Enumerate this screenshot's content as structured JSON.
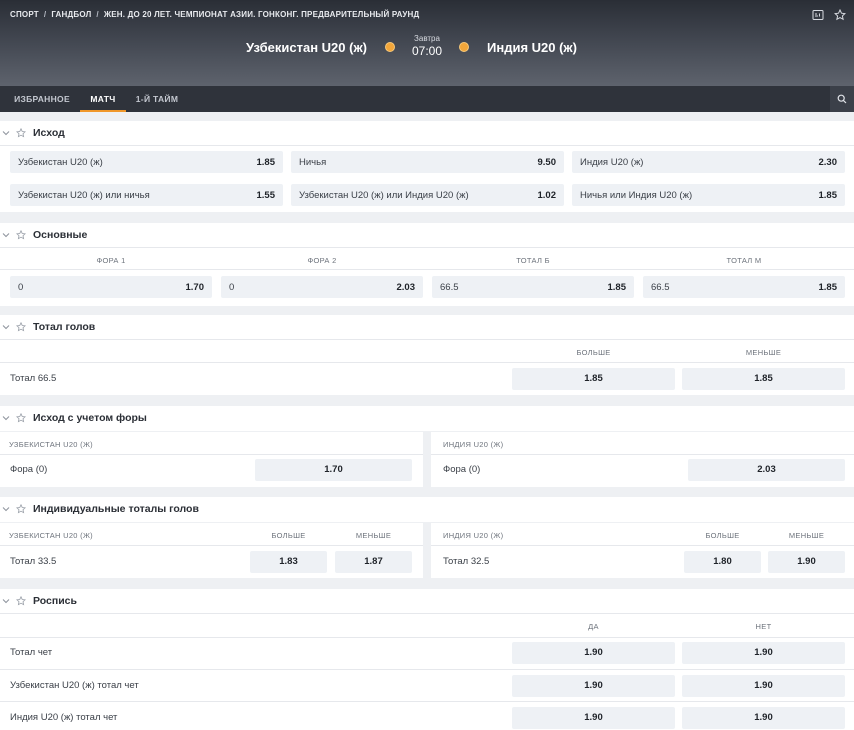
{
  "breadcrumbs": [
    "СПОРТ",
    "ГАНДБОЛ",
    "ЖЕН. ДО 20 ЛЕТ. ЧЕМПИОНАТ АЗИИ. ГОНКОНГ. ПРЕДВАРИТЕЛЬНЫЙ РАУНД"
  ],
  "breadcrumb_sep": "/",
  "icons": {
    "header": [
      "scoreboard-icon",
      "star-icon"
    ],
    "search": "search-icon",
    "collapse": "chevron-down-icon",
    "favorite": "star-icon"
  },
  "colors": {
    "accent": "#f0972a",
    "header_bg": "#2a2e36",
    "cell_bg": "#eef1f5"
  },
  "match": {
    "home": "Узбекистан U20 (ж)",
    "away": "Индия U20 (ж)",
    "day": "Завтра",
    "time": "07:00"
  },
  "tabs": [
    "ИЗБРАННОЕ",
    "МАТЧ",
    "1-Й ТАЙМ"
  ],
  "active_tab": "МАТЧ",
  "outcome": {
    "title": "Исход",
    "rows": [
      [
        {
          "label": "Узбекистан U20 (ж)",
          "odd": "1.85"
        },
        {
          "label": "Ничья",
          "odd": "9.50"
        },
        {
          "label": "Индия U20 (ж)",
          "odd": "2.30"
        }
      ],
      [
        {
          "label": "Узбекистан U20 (ж) или ничья",
          "odd": "1.55"
        },
        {
          "label": "Узбекистан U20 (ж) или Индия U20 (ж)",
          "odd": "1.02"
        },
        {
          "label": "Ничья или Индия U20 (ж)",
          "odd": "1.85"
        }
      ]
    ]
  },
  "main_markets": {
    "title": "Основные",
    "columns": [
      "ФОРА 1",
      "ФОРА 2",
      "ТОТАЛ Б",
      "ТОТАЛ М"
    ],
    "cells": [
      {
        "label": "0",
        "odd": "1.70"
      },
      {
        "label": "0",
        "odd": "2.03"
      },
      {
        "label": "66.5",
        "odd": "1.85"
      },
      {
        "label": "66.5",
        "odd": "1.85"
      }
    ]
  },
  "total_goals": {
    "title": "Тотал голов",
    "columns": [
      "БОЛЬШЕ",
      "МЕНЬШЕ"
    ],
    "row": {
      "label": "Тотал 66.5",
      "over": "1.85",
      "under": "1.85"
    }
  },
  "handicap": {
    "title": "Исход с учетом форы",
    "left": {
      "team": "УЗБЕКИСТАН U20 (Ж)",
      "label": "Фора (0)",
      "odd": "1.70"
    },
    "right": {
      "team": "ИНДИЯ U20 (Ж)",
      "label": "Фора (0)",
      "odd": "2.03"
    }
  },
  "individual_totals": {
    "title": "Индивидуальные тоталы голов",
    "columns": [
      "БОЛЬШЕ",
      "МЕНЬШЕ"
    ],
    "left": {
      "team": "УЗБЕКИСТАН U20 (Ж)",
      "label": "Тотал 33.5",
      "over": "1.83",
      "under": "1.87"
    },
    "right": {
      "team": "ИНДИЯ U20 (Ж)",
      "label": "Тотал 32.5",
      "over": "1.80",
      "under": "1.90"
    }
  },
  "props": {
    "title": "Роспись",
    "columns": [
      "ДА",
      "НЕТ"
    ],
    "rows": [
      {
        "label": "Тотал чет",
        "yes": "1.90",
        "no": "1.90"
      },
      {
        "label": "Узбекистан U20 (ж) тотал чет",
        "yes": "1.90",
        "no": "1.90"
      },
      {
        "label": "Индия U20 (ж) тотал чет",
        "yes": "1.90",
        "no": "1.90"
      }
    ]
  }
}
